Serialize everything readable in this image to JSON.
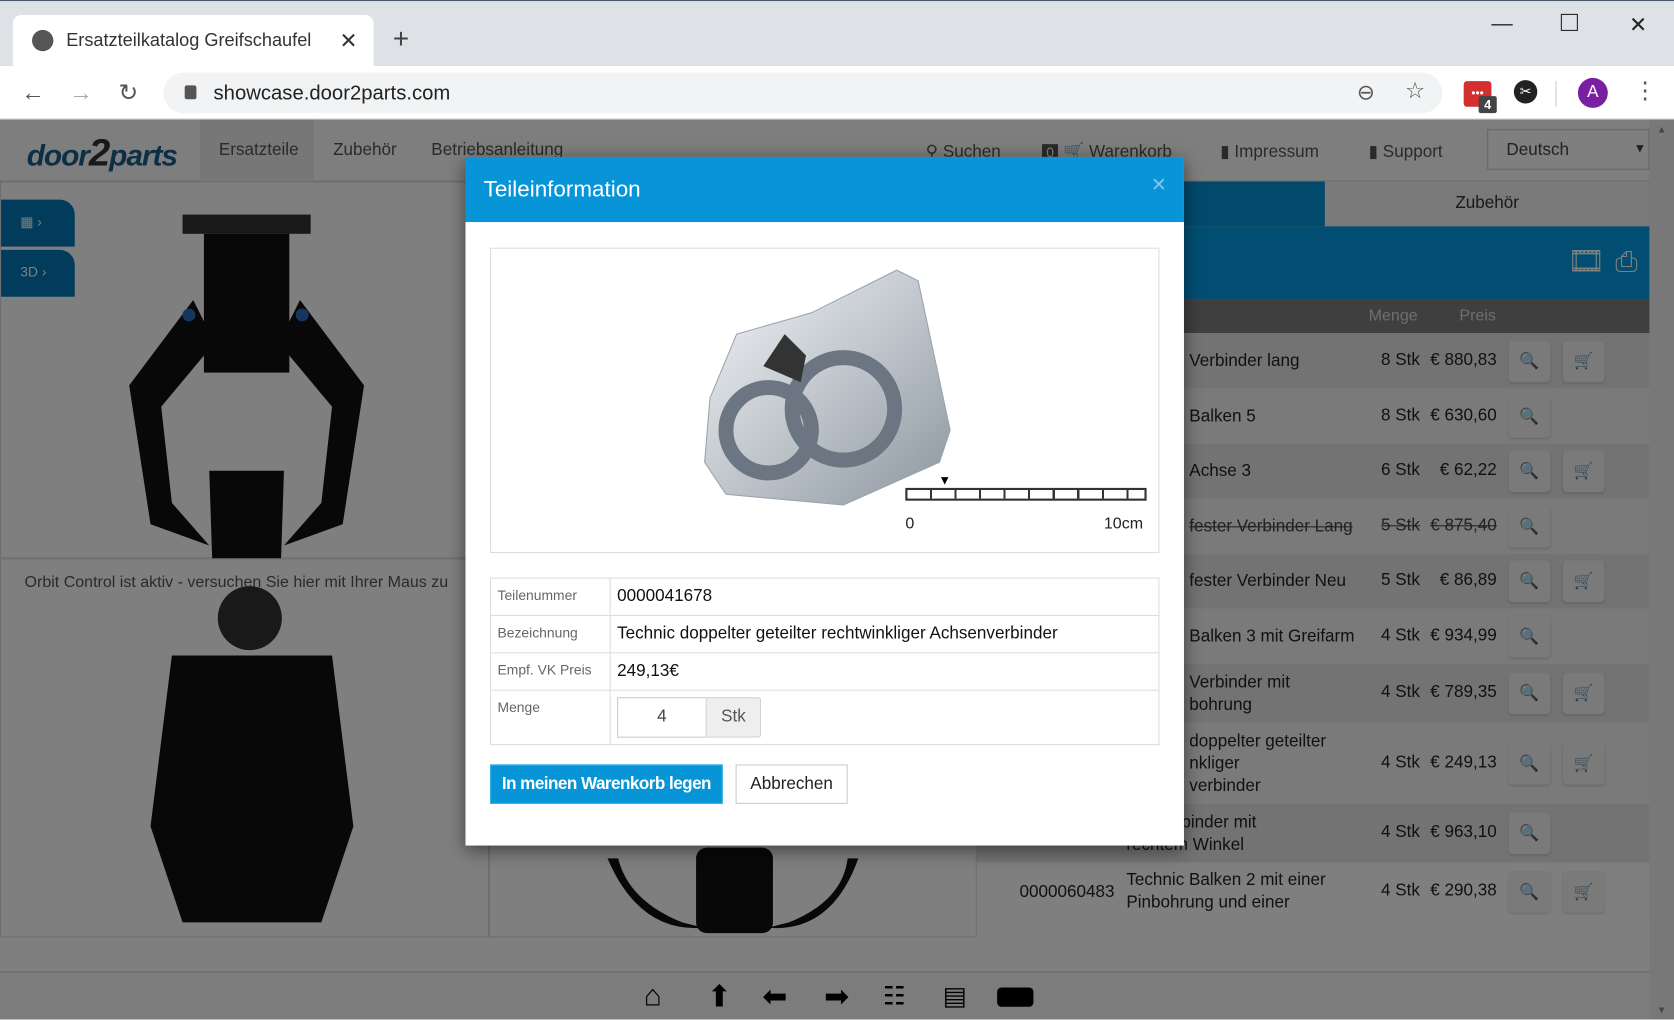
{
  "browser": {
    "tab_title": "Ersatzteilkatalog Greifschaufel",
    "url": "showcase.door2parts.com",
    "extension_badge": "4",
    "avatar_letter": "A"
  },
  "header": {
    "logo": {
      "part1": "door",
      "part2": "2",
      "part3": "parts"
    },
    "nav": [
      "Ersatzteile",
      "Zubehör",
      "Betriebsanleitung"
    ],
    "search_label": "Suchen",
    "cart_count": "0",
    "cart_label": "Warenkorb",
    "impressum_label": "Impressum",
    "support_label": "Support",
    "language": "Deutsch"
  },
  "viewer": {
    "side_buttons": [
      "qr-code",
      "3D"
    ],
    "orbit_hint": "Orbit Control ist aktiv - versuchen Sie hier mit Ihrer Maus zu"
  },
  "parts_panel": {
    "tab_accessories": "Zubehör",
    "col_qty": "Menge",
    "col_price": "Preis",
    "rows": [
      {
        "number": "",
        "name": "Verbinder lang",
        "qty": "8 Stk",
        "price": "€ 880,83",
        "cart": true,
        "strike": false
      },
      {
        "number": "",
        "name": "Balken 5",
        "qty": "8 Stk",
        "price": "€ 630,60",
        "cart": false,
        "strike": false
      },
      {
        "number": "",
        "name": "Achse 3",
        "qty": "6 Stk",
        "price": "€ 62,22",
        "cart": true,
        "strike": false
      },
      {
        "number": "",
        "name": "fester Verbinder Lang",
        "qty": "5 Stk",
        "price": "€ 875,40",
        "cart": false,
        "strike": true
      },
      {
        "number": "",
        "name": "fester Verbinder Neu",
        "qty": "5 Stk",
        "price": "€ 86,89",
        "cart": true,
        "strike": false
      },
      {
        "number": "",
        "name": "Balken 3 mit Greifarm",
        "qty": "4 Stk",
        "price": "€ 934,99",
        "cart": false,
        "strike": false
      },
      {
        "number": "",
        "name": "Verbinder mit\nbohrung",
        "qty": "4 Stk",
        "price": "€ 789,35",
        "cart": true,
        "strike": false
      },
      {
        "number": "",
        "name": "doppelter geteilter\nnkliger\nverbinder",
        "qty": "4 Stk",
        "price": "€ 249,13",
        "cart": true,
        "strike": false
      },
      {
        "number": "",
        "name": "Pin Verbinder mit\nrechtem Winkel",
        "qty": "4 Stk",
        "price": "€ 963,10",
        "cart": false,
        "strike": false
      },
      {
        "number": "0000060483",
        "name": "Technic Balken 2 mit einer\nPinbohrung und einer",
        "qty": "4 Stk",
        "price": "€ 290,38",
        "cart": true,
        "strike": false
      }
    ]
  },
  "bottom_toolbar": [
    "home-icon",
    "arrow-up-icon",
    "arrow-left-icon",
    "arrow-right-icon",
    "tree-icon",
    "image-list-icon",
    "vr-glasses-icon"
  ],
  "modal": {
    "title": "Teileinformation",
    "scale_start": "0",
    "scale_end": "10cm",
    "labels": {
      "part_number": "Teilenummer",
      "designation": "Bezeichnung",
      "price": "Empf. VK Preis",
      "quantity": "Menge"
    },
    "part_number": "0000041678",
    "designation": "Technic doppelter geteilter rechtwinkliger Achsenverbinder",
    "price": "249,13€",
    "quantity": "4",
    "unit": "Stk",
    "add_to_cart": "In meinen Warenkorb legen",
    "cancel": "Abbrechen"
  },
  "colors": {
    "accent": "#0795d8",
    "brand": "#1a5e8c"
  }
}
